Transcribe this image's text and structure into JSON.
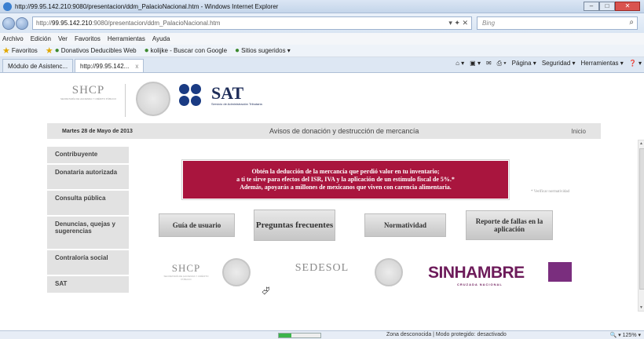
{
  "window": {
    "title": "http://99.95.142.210:9080/presentacion/ddm_PalacioNacional.htm - Windows Internet Explorer",
    "minimize": "–",
    "maximize": "□",
    "close": "✕"
  },
  "address": {
    "prefix": "http://",
    "host": "99.95.142.210",
    "path": ":9080/presentacion/ddm_PalacioNacional.htm",
    "controls": "▾ ✦ ✕",
    "search_placeholder": "Bing",
    "search_icon": "⌕"
  },
  "menu": [
    "Archivo",
    "Edición",
    "Ver",
    "Favoritos",
    "Herramientas",
    "Ayuda"
  ],
  "favorites": {
    "label": "Favoritos",
    "items": [
      "Donativos Deducibles Web",
      "kolijke - Buscar con Google",
      "Sitios sugeridos ▾"
    ]
  },
  "tabs": [
    {
      "label": "Módulo de Asistenc...",
      "active": false
    },
    {
      "label": "http://99.95.142...",
      "active": true
    }
  ],
  "tab_close": "x",
  "command_bar": [
    "⌂ ▾",
    "▣ ▾",
    "✉",
    "⎙ ▾",
    "Página ▾",
    "Seguridad ▾",
    "Herramientas ▾",
    "❓ ▾"
  ],
  "header": {
    "shcp": "SHCP",
    "shcp_sub": "SECRETARÍA DE HACIENDA Y CRÉDITO PÚBLICO",
    "sat": "SAT",
    "sat_sub": "Servicio de Administración Tributaria"
  },
  "datebar": {
    "date": "Martes 28 de Mayo de 2013",
    "section_title": "Avisos de donación y destrucción de mercancía",
    "home": "Inicio"
  },
  "sidebar": [
    "Contribuyente",
    "Donataria autorizada",
    "Consulta pública",
    "Denuncias, quejas y sugerencias",
    "Contraloría social",
    "SAT"
  ],
  "banner": {
    "line1": "Obtén la deducción de la mercancía que perdió valor en tu inventario;",
    "line2": "a ti te sirve para efectos del ISR, IVA y la aplicación de un estímulo fiscal de 5%.*",
    "line3": "Además, apoyarás a millones de mexicanos que viven con carencia alimentaria."
  },
  "buttons": {
    "guide": "Guía de usuario",
    "faq": "Preguntas frecuentes",
    "rules": "Normatividad",
    "report": "Reporte de fallas en la aplicación"
  },
  "footer": {
    "shcp": "SHCP",
    "sedesol": "SEDESOL",
    "sinhambre": "SINHAMBRE",
    "cruzada": "CRUZADA NACIONAL",
    "verify": "* Verificar normatividad"
  },
  "status": {
    "zone": "Zona desconocida | Modo protegido: desactivado",
    "zoom": "🔍 ▾  125% ▾"
  },
  "colors": {
    "banner": "#a9153e",
    "sat_blue": "#1a3b83",
    "sinhambre_purple": "#6d1b5a"
  }
}
